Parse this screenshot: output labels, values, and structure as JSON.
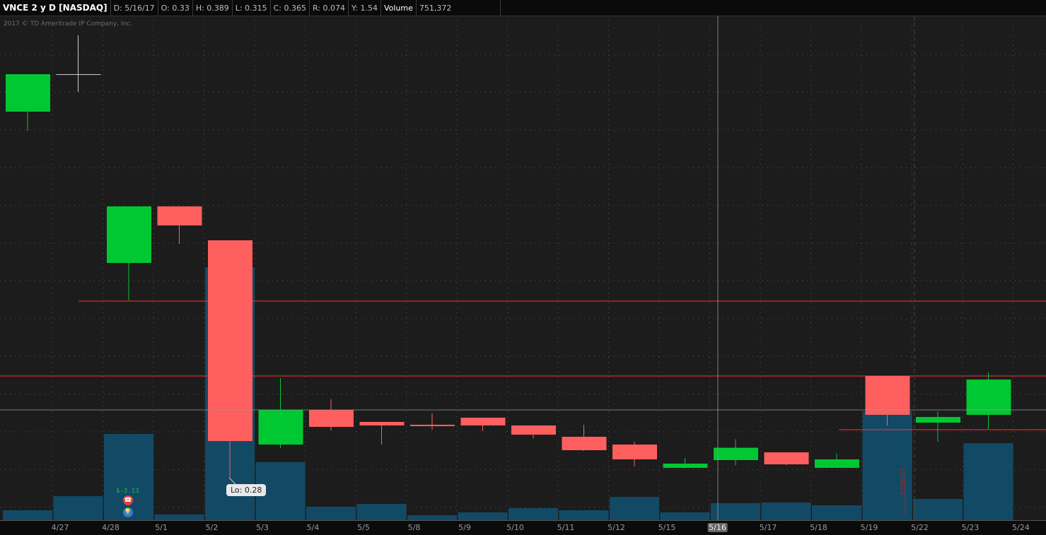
{
  "header": {
    "symbol": "VNCE 2 y D [NASDAQ]",
    "date": "D: 5/16/17",
    "open": "O: 0.33",
    "high": "H: 0.389",
    "low": "L: 0.315",
    "close": "C: 0.365",
    "range": "R: 0.074",
    "y": "Y: 1.54",
    "volume_label": "Volume",
    "volume_value": "751,372"
  },
  "copyright": "2017 © TD Ameritrade IP Company, Inc.",
  "colors": {
    "up": "#00c832",
    "down": "#ff5f5f",
    "volume": "#124a66",
    "bg": "#1c1c1c",
    "level": "#ff3030"
  },
  "annotations": {
    "low_tooltip": "Lo: 0.28",
    "pl_text": "$-3.13",
    "earnings_date": "5/19/17",
    "phone_icon": "phone-icon",
    "bulb_icon": "lightbulb-icon"
  },
  "chart_data": {
    "type": "candlestick",
    "title": "VNCE 2 y D [NASDAQ]",
    "x_labels": [
      "4/27",
      "4/28",
      "5/1",
      "5/2",
      "5/3",
      "5/4",
      "5/5",
      "5/8",
      "5/9",
      "5/10",
      "5/11",
      "5/12",
      "5/15",
      "5/16",
      "5/17",
      "5/18",
      "5/19",
      "5/22",
      "5/23",
      "5/24"
    ],
    "highlighted_label": "5/16",
    "candles": [
      {
        "o": 1.316,
        "h": 1.422,
        "l": 1.262,
        "c": 1.422,
        "v": 438000
      },
      {
        "o": 1.422,
        "h": 1.532,
        "l": 1.372,
        "c": 1.422,
        "v": 1064000
      },
      {
        "o": 0.888,
        "h": 1.048,
        "l": 0.782,
        "c": 1.048,
        "v": 3820000
      },
      {
        "o": 1.048,
        "h": 1.048,
        "l": 0.942,
        "c": 0.994,
        "v": 250000
      },
      {
        "o": 0.952,
        "h": 0.952,
        "l": 0.28,
        "c": 0.384,
        "v": 11200000
      },
      {
        "o": 0.374,
        "h": 0.562,
        "l": 0.364,
        "c": 0.472,
        "v": 2570000
      },
      {
        "o": 0.472,
        "h": 0.502,
        "l": 0.414,
        "c": 0.424,
        "v": 595000
      },
      {
        "o": 0.438,
        "h": 0.438,
        "l": 0.374,
        "c": 0.428,
        "v": 720000
      },
      {
        "o": 0.43,
        "h": 0.462,
        "l": 0.416,
        "c": 0.426,
        "v": 219000
      },
      {
        "o": 0.45,
        "h": 0.45,
        "l": 0.412,
        "c": 0.428,
        "v": 344000
      },
      {
        "o": 0.428,
        "h": 0.428,
        "l": 0.392,
        "c": 0.402,
        "v": 532000
      },
      {
        "o": 0.396,
        "h": 0.43,
        "l": 0.356,
        "c": 0.358,
        "v": 438000
      },
      {
        "o": 0.374,
        "h": 0.382,
        "l": 0.312,
        "c": 0.332,
        "v": 1030000
      },
      {
        "o": 0.308,
        "h": 0.336,
        "l": 0.306,
        "c": 0.32,
        "v": 344000
      },
      {
        "o": 0.33,
        "h": 0.389,
        "l": 0.315,
        "c": 0.365,
        "v": 751372
      },
      {
        "o": 0.352,
        "h": 0.352,
        "l": 0.316,
        "c": 0.318,
        "v": 783000
      },
      {
        "o": 0.308,
        "h": 0.348,
        "l": 0.308,
        "c": 0.332,
        "v": 657000
      },
      {
        "o": 0.568,
        "h": 0.568,
        "l": 0.428,
        "c": 0.458,
        "v": 4820000
      },
      {
        "o": 0.436,
        "h": 0.468,
        "l": 0.382,
        "c": 0.452,
        "v": 939000
      },
      {
        "o": 0.458,
        "h": 0.578,
        "l": 0.418,
        "c": 0.558,
        "v": 3410000
      }
    ],
    "levels": [
      0.78,
      0.568,
      0.416
    ],
    "crosshair_price": 0.472,
    "grid": true
  }
}
